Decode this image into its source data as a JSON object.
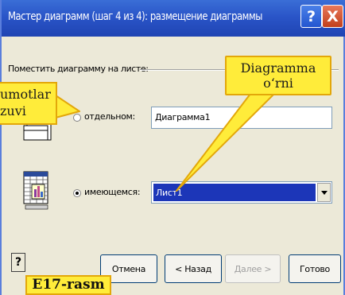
{
  "window": {
    "title": "Мастер диаграмм (шаг 4 из 4): размещение диаграммы",
    "help_label": "?",
    "close_label": "X"
  },
  "group": {
    "label": "Поместить диаграмму на листе:"
  },
  "options": {
    "separate": {
      "label": "отдельном:",
      "value": "Диаграмма1",
      "selected": false
    },
    "existing": {
      "label": "имеющемся:",
      "value": "Лист1",
      "selected": true
    }
  },
  "buttons": {
    "help": "?",
    "cancel": "Отмена",
    "back": "< Назад",
    "next": "Далее >",
    "finish": "Готово"
  },
  "annotations": {
    "callout_right": [
      "Diagramma",
      "o‘rni"
    ],
    "callout_left": [
      "umotlar",
      "zuvi"
    ],
    "caption": "E17-rasm"
  },
  "colors": {
    "titlebar": "#2a55c8",
    "selection": "#1c36b8",
    "callout": "#ffec3a"
  }
}
